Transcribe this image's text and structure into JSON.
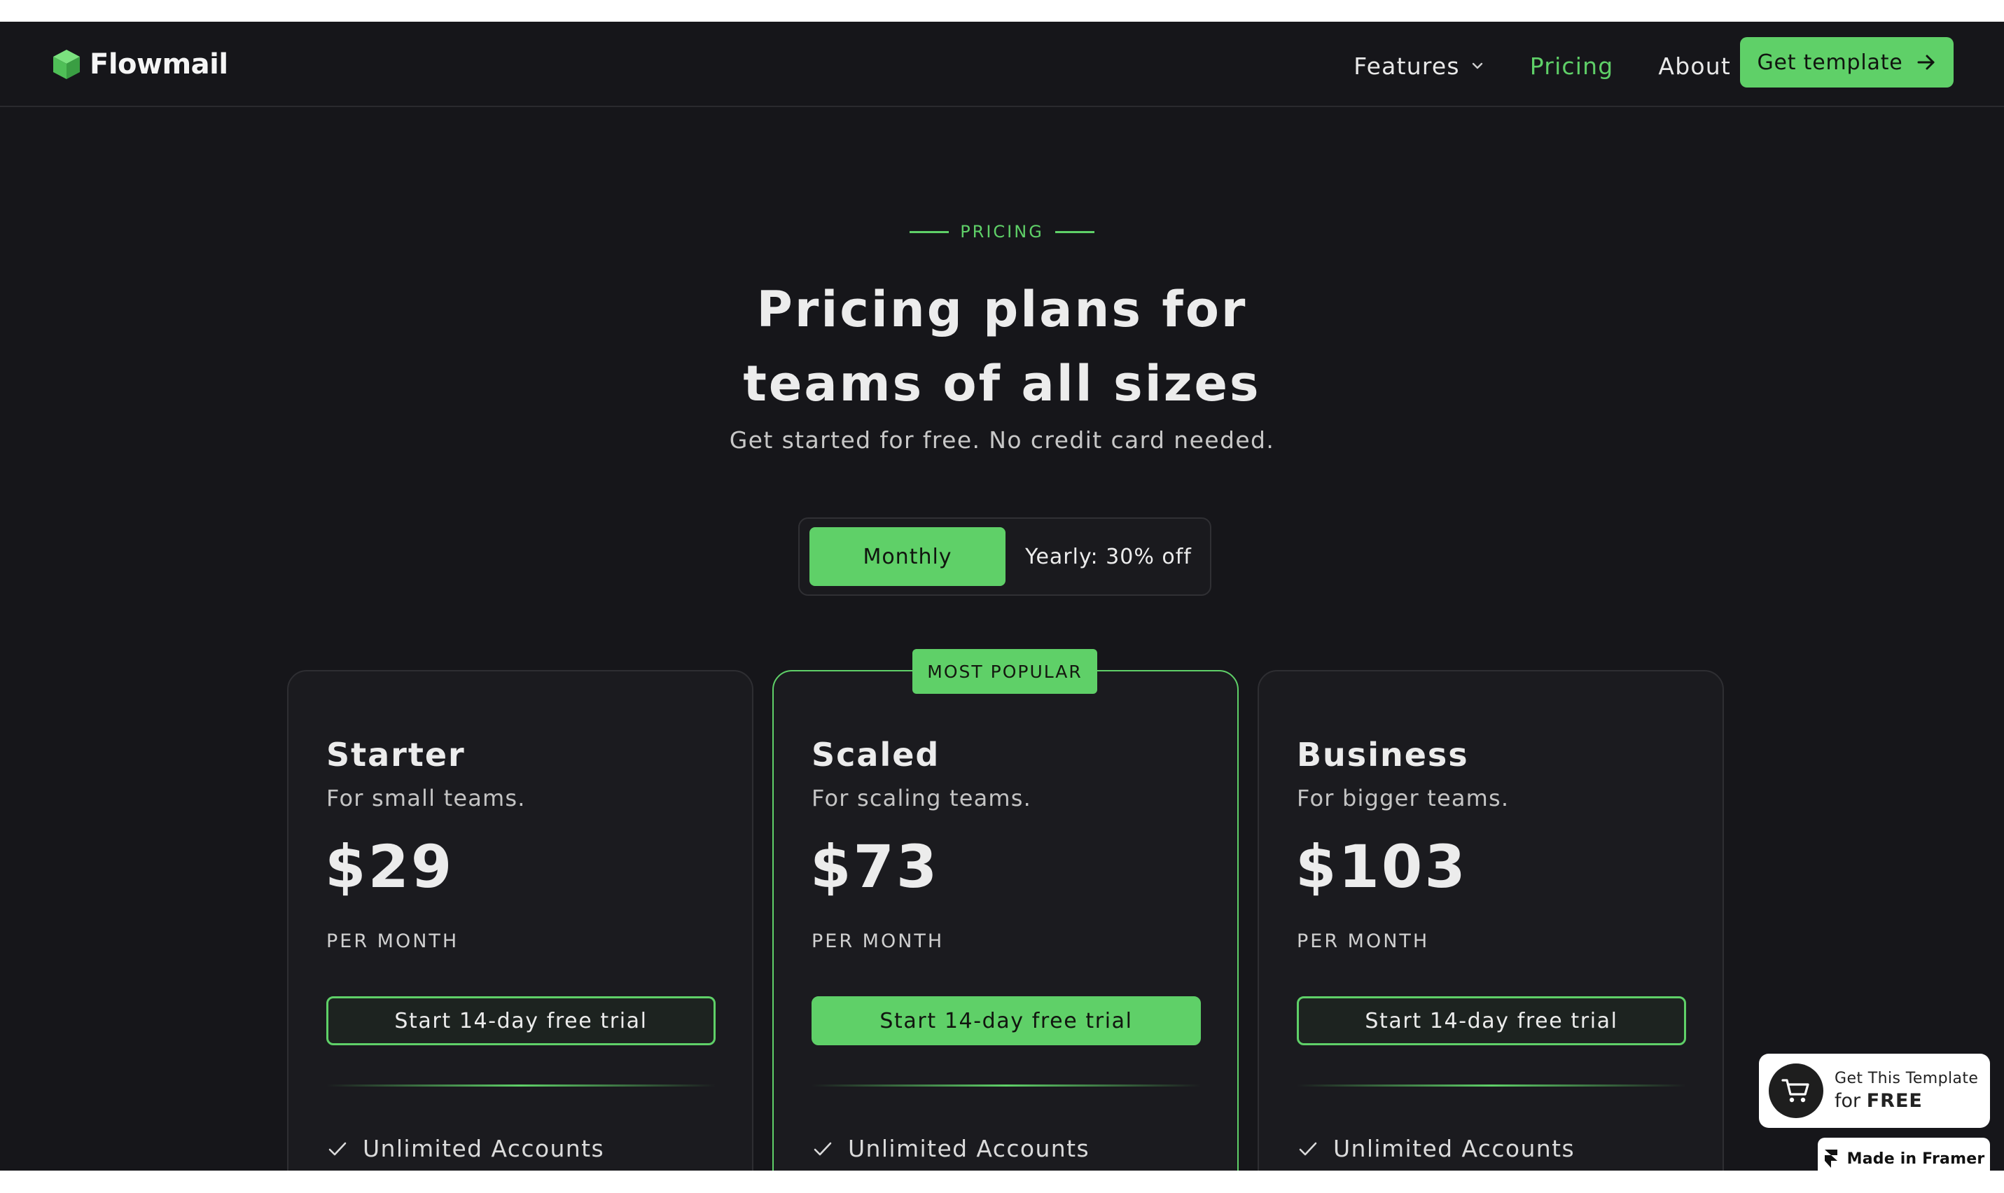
{
  "brand": {
    "name": "Flowmail",
    "logo_icon": "green-cube-icon",
    "accent": "#5fd068",
    "background": "#16161a"
  },
  "nav": {
    "items": [
      {
        "label": "Features",
        "has_dropdown": true,
        "active": false
      },
      {
        "label": "Pricing",
        "has_dropdown": false,
        "active": true
      },
      {
        "label": "About",
        "has_dropdown": false,
        "active": false
      }
    ],
    "cta_label": "Get template"
  },
  "hero": {
    "eyebrow": "PRICING",
    "title_line1": "Pricing plans for",
    "title_line2": "teams of all sizes",
    "subtitle": "Get started for free. No credit card needed."
  },
  "billing_toggle": {
    "options": [
      "Monthly",
      "Yearly: 30% off"
    ],
    "selected": "Monthly"
  },
  "plans": [
    {
      "name": "Starter",
      "description": "For small teams.",
      "price": "$29",
      "period": "PER MONTH",
      "button": "Start 14-day free trial",
      "features": [
        "Unlimited Accounts"
      ],
      "popular": false
    },
    {
      "name": "Scaled",
      "description": "For scaling teams.",
      "price": "$73",
      "period": "PER MONTH",
      "button": "Start 14-day free trial",
      "features": [
        "Unlimited Accounts"
      ],
      "popular": true,
      "badge": "MOST POPULAR"
    },
    {
      "name": "Business",
      "description": "For bigger teams.",
      "price": "$103",
      "period": "PER MONTH",
      "button": "Start 14-day free trial",
      "features": [
        "Unlimited Accounts"
      ],
      "popular": false
    }
  ],
  "promo": {
    "line1": "Get This Template",
    "line2_prefix": "for",
    "line2_strong": "FREE"
  },
  "framer_badge": {
    "label": "Made in Framer"
  }
}
